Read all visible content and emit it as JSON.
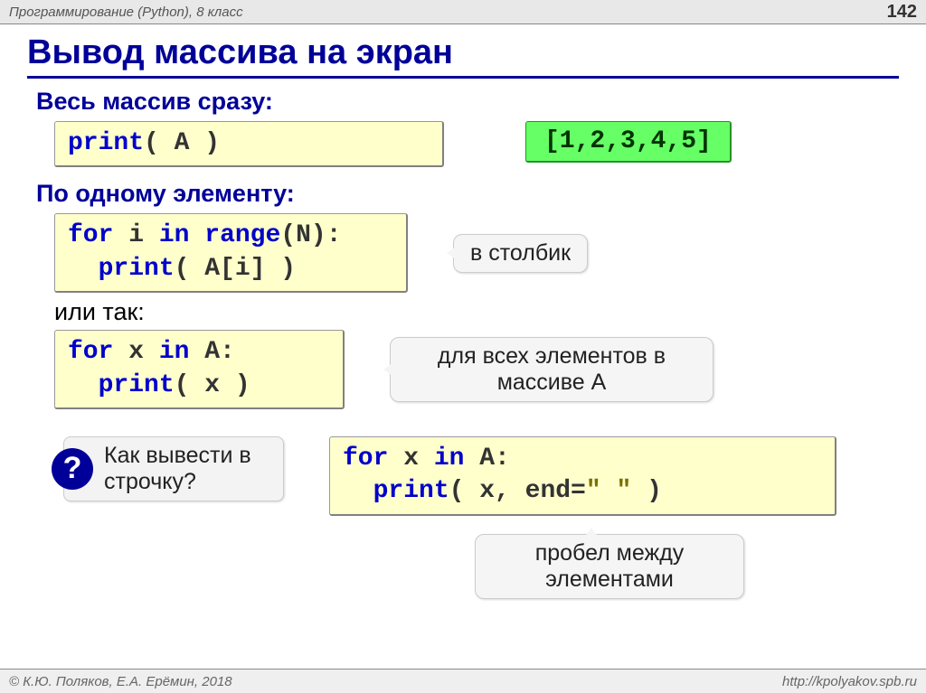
{
  "header": {
    "course": "Программирование (Python), 8 класс",
    "page": "142"
  },
  "title": "Вывод массива на экран",
  "sec1": {
    "head": "Весь массив сразу:",
    "code_html": "<span class='kw'>print</span><span class='txt'>( A )</span>",
    "output": "[1,2,3,4,5]"
  },
  "sec2": {
    "head": "По одному элементу:",
    "code_html": "<span class='kw'>for</span><span class='txt'> i </span><span class='kw'>in</span><span class='txt'> </span><span class='kw'>range</span><span class='txt'>(N):</span>\n  <span class='kw'>print</span><span class='txt'>( A[i] )</span>",
    "callout": "в столбик"
  },
  "sec3": {
    "label": "или так:",
    "code_html": "<span class='kw'>for</span><span class='txt'> x </span><span class='kw'>in</span><span class='txt'> A:</span>\n  <span class='kw'>print</span><span class='txt'>( x )</span>",
    "callout": "для всех элементов в массиве A"
  },
  "sec4": {
    "qmark": "?",
    "question": "Как вывести в строчку?",
    "code_html": "<span class='kw'>for</span><span class='txt'> x </span><span class='kw'>in</span><span class='txt'> A:</span>\n  <span class='kw'>print</span><span class='txt'>( x, end=</span><span class='str'>\" \"</span><span class='txt'> )</span>",
    "callout": "пробел между элементами"
  },
  "footer": {
    "left": "© К.Ю. Поляков, Е.А. Ерёмин, 2018",
    "right": "http://kpolyakov.spb.ru"
  }
}
